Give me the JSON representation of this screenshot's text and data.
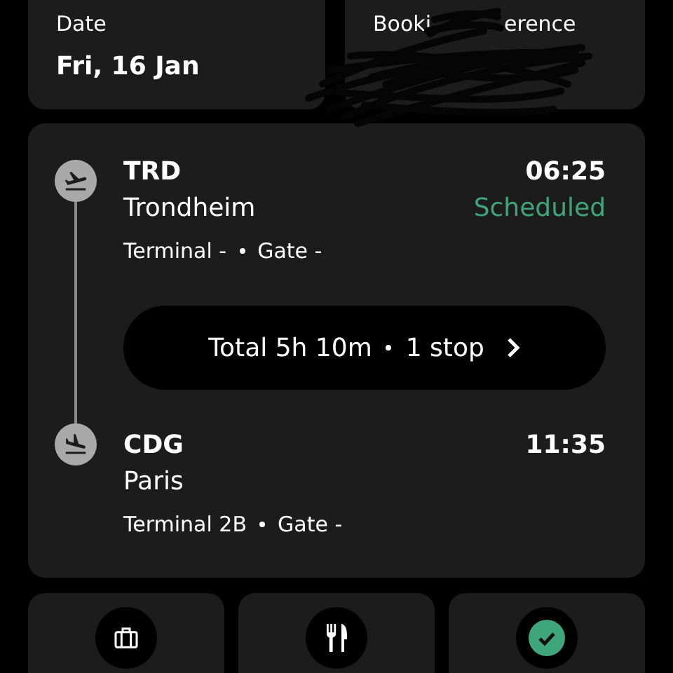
{
  "date": {
    "label": "Date",
    "value": "Fri, 16 Jan"
  },
  "booking_reference": {
    "label_parts": [
      "Booki",
      "erence"
    ]
  },
  "departure": {
    "code": "TRD",
    "city": "Trondheim",
    "time": "06:25",
    "status": "Scheduled",
    "terminal": "Terminal -",
    "gate": "Gate -"
  },
  "summary": {
    "duration": "Total 5h 10m",
    "stops": "1 stop"
  },
  "arrival": {
    "code": "CDG",
    "city": "Paris",
    "time": "11:35",
    "terminal": "Terminal 2B",
    "gate": "Gate -"
  },
  "actions": [
    {
      "kind": "baggage"
    },
    {
      "kind": "meal"
    },
    {
      "kind": "checkin"
    }
  ]
}
